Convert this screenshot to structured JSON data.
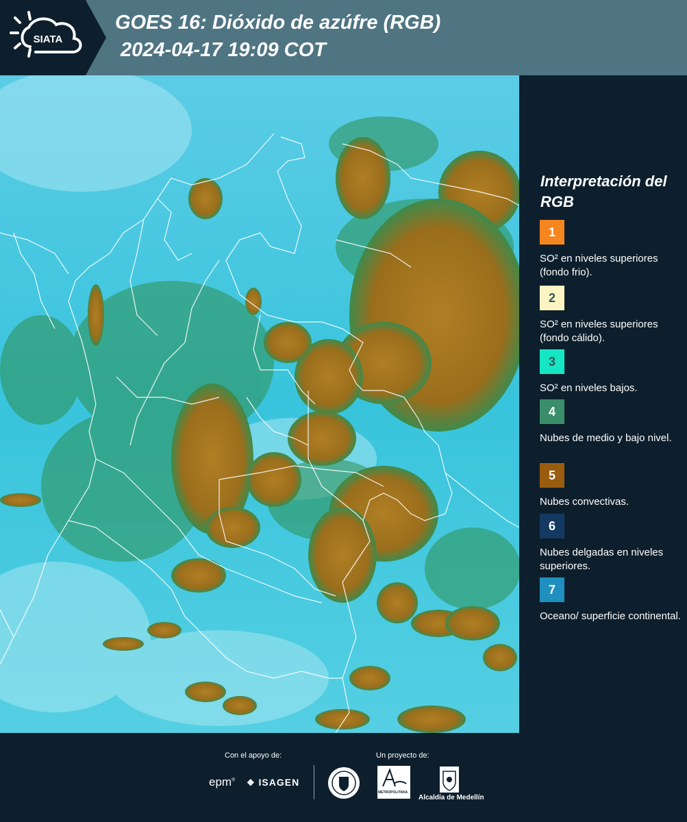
{
  "header": {
    "logo_text": "SIATA",
    "title": "GOES 16: Dióxido de azúfre (RGB)",
    "subtitle": "2024-04-17 19:09 COT"
  },
  "legend": {
    "title": "Interpretación del RGB",
    "items": [
      {
        "number": "1",
        "color": "#f5861f",
        "text": "SO² en niveles superiores (fondo frio)."
      },
      {
        "number": "2",
        "color": "#fdf4c3",
        "text": "SO² en niveles superiores (fondo cálido)."
      },
      {
        "number": "3",
        "color": "#17e6c4",
        "text": "SO² en niveles bajos."
      },
      {
        "number": "4",
        "color": "#3a8f6a",
        "text": "Nubes de medio y bajo nivel."
      },
      {
        "number": "5",
        "color": "#9a5c0e",
        "text": "Nubes convectivas."
      },
      {
        "number": "6",
        "color": "#143a63",
        "text": "Nubes delgadas en niveles superiores."
      },
      {
        "number": "7",
        "color": "#1f8fbf",
        "text": "Oceano/ superficie continental."
      }
    ]
  },
  "footer": {
    "support_label": "Con el apoyo de:",
    "project_label": "Un proyecto de:",
    "sponsor_epm": "epm",
    "sponsor_isagen": "ISAGEN",
    "sponsor_area": "METROPOLITANA",
    "sponsor_alcaldia": "Alcaldía de Medellín"
  },
  "colors": {
    "header_bg": "#4f7482",
    "panel_bg": "#0d1f2d",
    "sea": "#40c8e0",
    "cloud": "#a6781f"
  }
}
